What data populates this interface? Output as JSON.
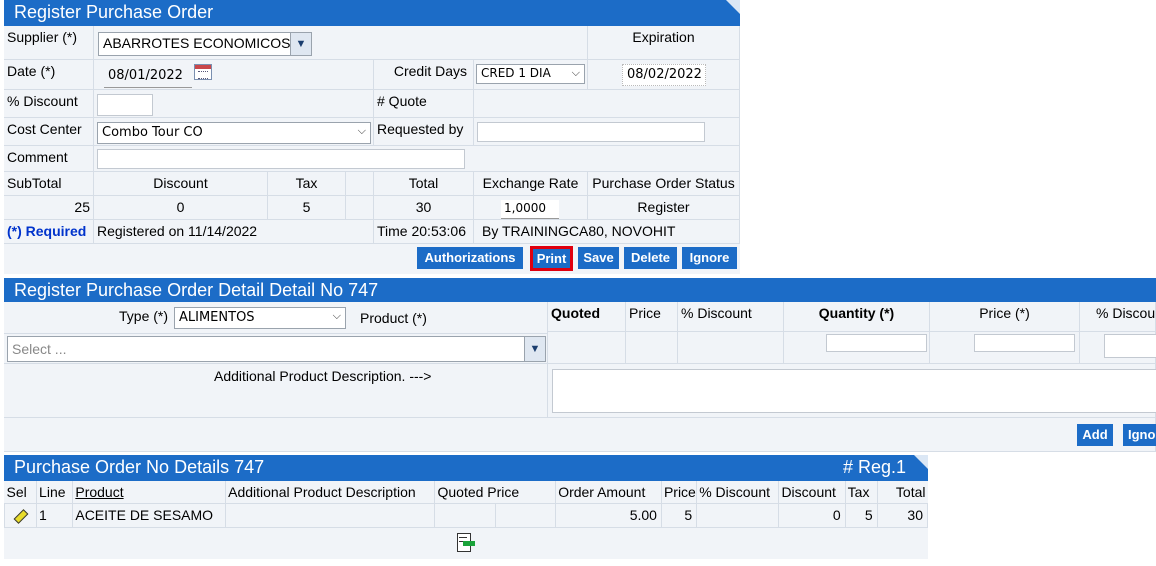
{
  "register_po": {
    "title": "Register Purchase Order",
    "supplier_label": "Supplier (*)",
    "supplier_value": "ABARROTES ECONOMICOS",
    "expiration_label": "Expiration",
    "date_label": "Date (*)",
    "date_value": "08/01/2022",
    "credit_days_label": "Credit Days",
    "credit_days_value": "CRED 1 DIA",
    "expiration_value": "08/02/2022",
    "discount_label": "% Discount",
    "discount_value": "",
    "quote_label": "# Quote",
    "cost_center_label": "Cost Center",
    "cost_center_value": "Combo Tour CO",
    "requested_by_label": "Requested by",
    "requested_by_value": "",
    "comment_label": "Comment",
    "comment_value": "",
    "subtotal_label": "SubTotal",
    "discount_col_label": "Discount",
    "tax_label": "Tax",
    "total_label": "Total",
    "exchange_rate_label": "Exchange Rate",
    "status_label": "Purchase Order Status",
    "subtotal_value": "25",
    "discount_col_value": "0",
    "tax_value": "5",
    "total_value": "30",
    "exchange_rate_value": "1,0000",
    "status_value": "Register",
    "required_note": "(*) Required",
    "registered_on": "Registered on  11/14/2022",
    "time_text": "Time 20:53:06",
    "by_text": "By TRAININGCA80, NOVOHIT",
    "buttons": {
      "authorizations": "Authorizations",
      "print": "Print",
      "save": "Save",
      "delete": "Delete",
      "ignore": "Ignore"
    }
  },
  "detail": {
    "title": "Register Purchase Order Detail Detail No 747",
    "type_label": "Type (*)",
    "type_value": "ALIMENTOS",
    "product_label": "Product (*)",
    "product_placeholder": "Select ...",
    "quoted_label": "Quoted",
    "price_label": "Price",
    "discount_label": "% Discount",
    "quantity_label": "Quantity (*)",
    "price_req_label": "Price (*)",
    "discount2_label": "% Discou",
    "additional_label": "Additional Product Description. --->",
    "add_button": "Add",
    "ignore_button": "Igno"
  },
  "details_table": {
    "title": "Purchase Order No Details 747",
    "reg_count": "# Reg.1",
    "columns": [
      "Sel",
      "Line",
      "Product",
      "Additional Product Description",
      "Quoted Price",
      "% Discount",
      "Order Amount",
      "Price",
      "% Discount",
      "Discount",
      "Tax",
      "Total"
    ],
    "rows": [
      {
        "line": "1",
        "product": "ACEITE DE SESAMO",
        "additional": "",
        "quoted_price": "",
        "discount_pct": "",
        "order_amount": "5.00",
        "price": "5",
        "discount_pct2": "",
        "discount": "0",
        "tax": "5",
        "total": "30"
      }
    ]
  },
  "colors": {
    "header_blue": "#1c6cc7",
    "cell_bg": "#f1f4f8",
    "required_blue": "#0033cc",
    "print_outline": "#e0000f"
  },
  "icons": [
    "calendar-icon",
    "chevron-down-icon",
    "edit-pencil-icon",
    "export-icon"
  ]
}
